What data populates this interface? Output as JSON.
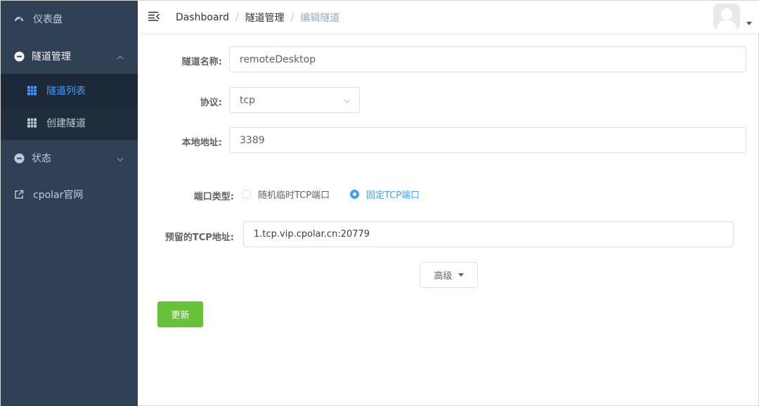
{
  "sidebar": {
    "items": [
      {
        "label": "仪表盘",
        "icon": "dashboard-icon"
      },
      {
        "label": "隧道管理",
        "icon": "circle-plus-icon",
        "expanded": true,
        "children": [
          {
            "label": "隧道列表",
            "icon": "grid-icon",
            "active": true
          },
          {
            "label": "创建隧道",
            "icon": "grid-icon"
          }
        ]
      },
      {
        "label": "状态",
        "icon": "circle-plus-icon",
        "expanded": false
      },
      {
        "label": "cpolar官网",
        "icon": "external-link-icon"
      }
    ]
  },
  "header": {
    "breadcrumb": [
      "Dashboard",
      "隧道管理",
      "编辑隧道"
    ],
    "separator": "/"
  },
  "form": {
    "tunnel_name_label": "隧道名称:",
    "tunnel_name_value": "remoteDesktop",
    "protocol_label": "协议:",
    "protocol_value": "tcp",
    "local_address_label": "本地地址:",
    "local_address_value": "3389",
    "port_type_label": "端口类型:",
    "port_type_options": [
      "随机临时TCP端口",
      "固定TCP端口"
    ],
    "port_type_selected": "固定TCP端口",
    "reserved_tcp_label": "预留的TCP地址:",
    "reserved_tcp_value": "1.tcp.vip.cpolar.cn:20779",
    "advanced_label": "高级",
    "update_label": "更新"
  },
  "colors": {
    "sidebar_bg": "#304156",
    "submenu_bg": "#1f2d3d",
    "accent": "#409eff",
    "success": "#67c23a"
  }
}
